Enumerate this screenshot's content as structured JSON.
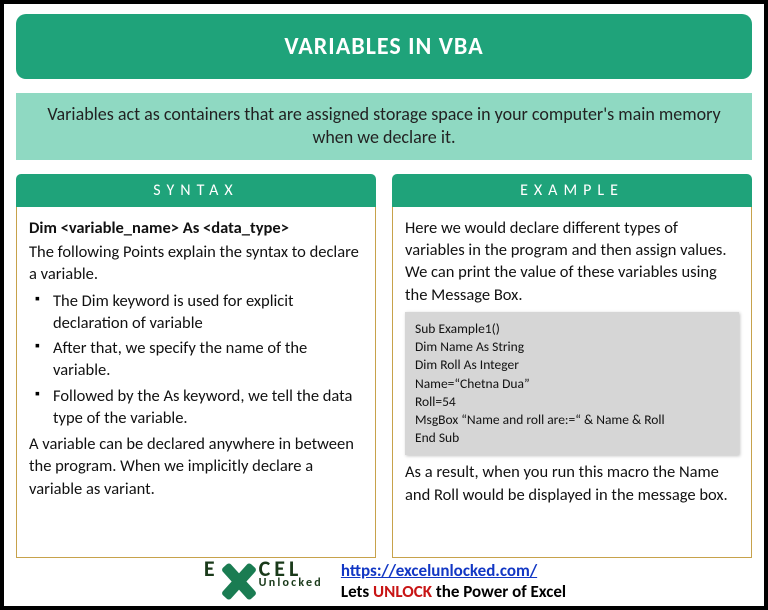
{
  "title": "VARIABLES IN VBA",
  "intro": "Variables act as containers that are assigned storage space in your computer's main memory when we declare it.",
  "syntax": {
    "header": "SYNTAX",
    "declaration": "Dim <variable_name> As <data_type>",
    "lead": "The following Points explain the syntax to declare a variable.",
    "points": [
      "The Dim keyword is used for explicit declaration of variable",
      "After that, we specify the name of the variable.",
      "Followed by the As keyword, we tell the data type of the variable."
    ],
    "tail": "A variable can be declared anywhere in between the program. When we implicitly declare a variable as variant."
  },
  "example": {
    "header": "EXAMPLE",
    "lead": "Here we would declare different types of variables in the program and then assign values. We can print the value of these variables using the Message Box.",
    "code": [
      "Sub Example1()",
      "Dim Name As String",
      "Dim Roll As Integer",
      "Name=“Chetna Dua”",
      "Roll=54",
      "MsgBox “Name and roll are:=“ & Name & Roll",
      "End Sub"
    ],
    "tail": "As a result, when you run this macro the Name and Roll would be displayed in the message box."
  },
  "footer": {
    "logo_top": "E   CEL",
    "logo_bottom": "Unlocked",
    "url": "https://excelunlocked.com/",
    "tag_pre": "Lets ",
    "tag_unlock": "UNLOCK",
    "tag_post": " the Power of Excel"
  }
}
